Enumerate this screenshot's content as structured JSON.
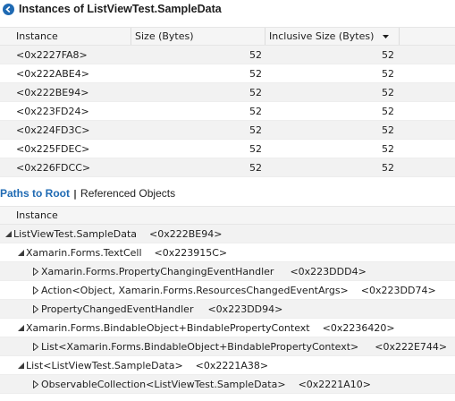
{
  "title": "Instances of ListViewTest.SampleData",
  "grid": {
    "columns": [
      "Instance",
      "Size (Bytes)",
      "Inclusive Size (Bytes)"
    ],
    "rows": [
      {
        "instance": "<0x2227FA8>",
        "size": "52",
        "inclusive": "52"
      },
      {
        "instance": "<0x222ABE4>",
        "size": "52",
        "inclusive": "52"
      },
      {
        "instance": "<0x222BE94>",
        "size": "52",
        "inclusive": "52"
      },
      {
        "instance": "<0x223FD24>",
        "size": "52",
        "inclusive": "52"
      },
      {
        "instance": "<0x224FD3C>",
        "size": "52",
        "inclusive": "52"
      },
      {
        "instance": "<0x225FDEC>",
        "size": "52",
        "inclusive": "52"
      },
      {
        "instance": "<0x226FDCC>",
        "size": "52",
        "inclusive": "52"
      }
    ]
  },
  "tabs": {
    "active": "Paths to Root",
    "separator": "|",
    "inactive": "Referenced Objects"
  },
  "tree": {
    "header": "Instance",
    "rows": [
      {
        "name": "ListViewTest.SampleData",
        "addr": "<0x222BE94>"
      },
      {
        "name": "Xamarin.Forms.TextCell",
        "addr": "<0x223915C>"
      },
      {
        "name": "Xamarin.Forms.PropertyChangingEventHandler",
        "addr": "<0x223DDD4>"
      },
      {
        "name": "Action<Object, Xamarin.Forms.ResourcesChangedEventArgs>",
        "addr": "<0x223DD74>"
      },
      {
        "name": "PropertyChangedEventHandler",
        "addr": "<0x223DD94>"
      },
      {
        "name": "Xamarin.Forms.BindableObject+BindablePropertyContext",
        "addr": "<0x2236420>"
      },
      {
        "name": "List<Xamarin.Forms.BindableObject+BindablePropertyContext>",
        "addr": "<0x222E744>"
      },
      {
        "name": "List<ListViewTest.SampleData>",
        "addr": "<0x2221A38>"
      },
      {
        "name": "ObservableCollection<ListViewTest.SampleData>",
        "addr": "<0x2221A10>"
      }
    ]
  },
  "icons": {
    "back": "back-arrow-icon",
    "sort": "sort-descending-icon",
    "expanded": "expanded-triangle-icon",
    "collapsed": "collapsed-triangle-icon"
  },
  "colors": {
    "accent": "#1f6ab3",
    "alt_row": "#f2f2f2",
    "header_bg": "#f5f5f5"
  }
}
